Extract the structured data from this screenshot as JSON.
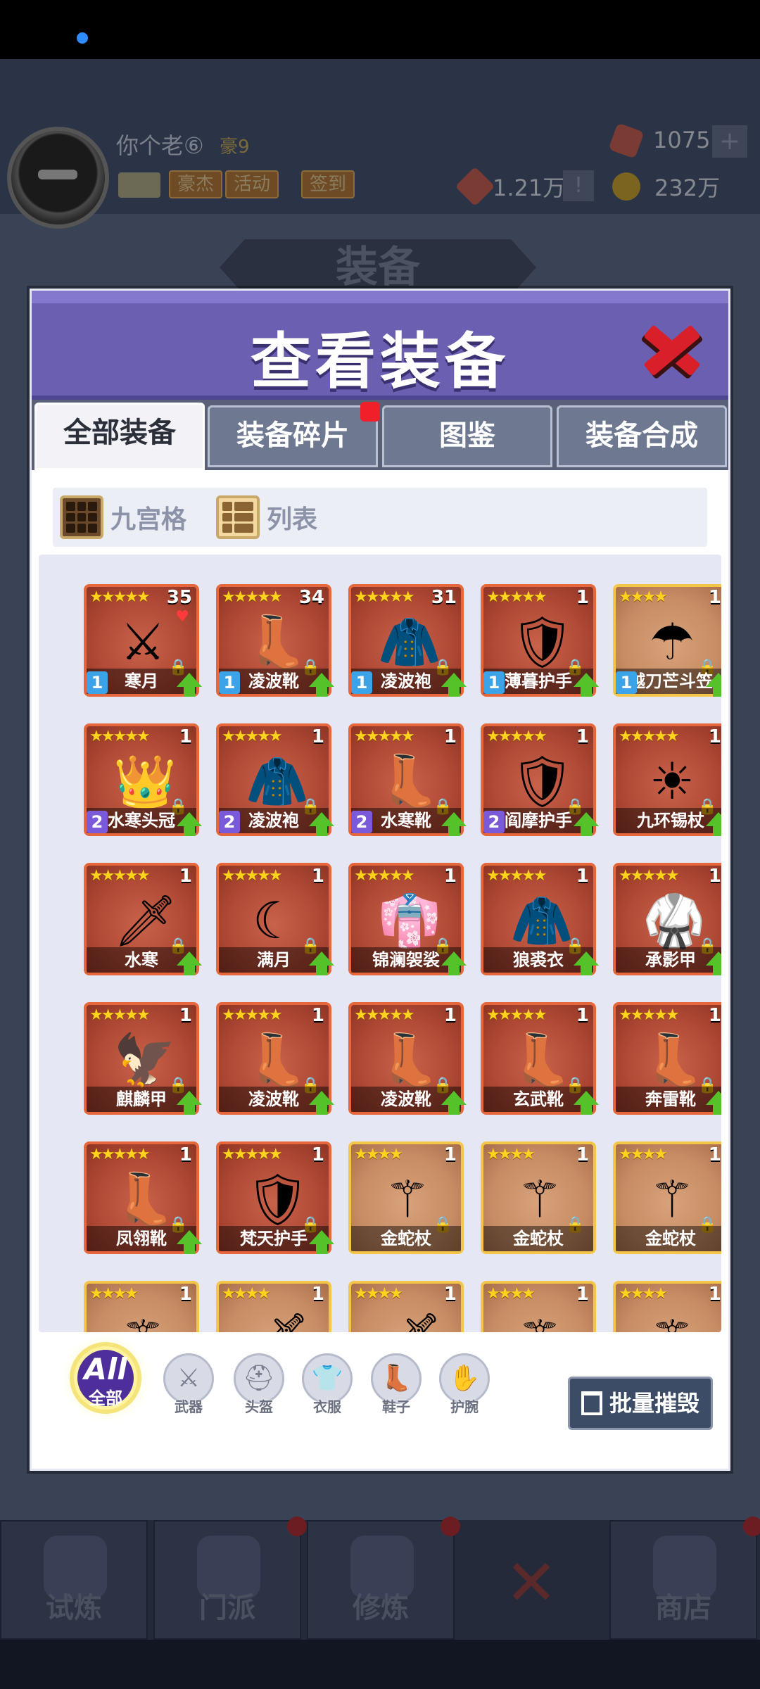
{
  "header": {
    "player_name": "你个老⑥",
    "player_rank": "豪9",
    "tags": [
      "豪杰",
      "活动",
      "签到"
    ],
    "gems": "1075",
    "power": "1.21万",
    "gold": "232万",
    "bg_title": "装备"
  },
  "modal": {
    "title": "查看装备",
    "tabs": [
      {
        "label": "全部装备",
        "active": true
      },
      {
        "label": "装备碎片",
        "badge": true
      },
      {
        "label": "图鉴"
      },
      {
        "label": "装备合成"
      }
    ],
    "view_modes": [
      "九宫格",
      "列表"
    ],
    "filters": {
      "all_label": "All",
      "all_sub": "全部",
      "items": [
        {
          "label": "武器",
          "icon": "swords-icon"
        },
        {
          "label": "头盔",
          "icon": "helmet-icon"
        },
        {
          "label": "衣服",
          "icon": "armor-icon"
        },
        {
          "label": "鞋子",
          "icon": "boots-icon"
        },
        {
          "label": "护腕",
          "icon": "bracer-icon"
        }
      ]
    },
    "batch_button": "批量摧毁"
  },
  "items": [
    {
      "name": "寒月",
      "stars": 5,
      "count": "35",
      "level": "1",
      "rarity": "red",
      "icon": "⚔",
      "heart": true
    },
    {
      "name": "凌波靴",
      "stars": 5,
      "count": "34",
      "level": "1",
      "rarity": "red",
      "icon": "👢"
    },
    {
      "name": "凌波袍",
      "stars": 5,
      "count": "31",
      "level": "1",
      "rarity": "red",
      "icon": "🧥"
    },
    {
      "name": "薄暮护手",
      "stars": 5,
      "count": "1",
      "level": "1",
      "rarity": "red",
      "icon": "🛡"
    },
    {
      "name": "越刀芒斗笠",
      "stars": 4,
      "count": "1",
      "level": "1",
      "rarity": "gold",
      "icon": "☂"
    },
    {
      "name": "水寒头冠",
      "stars": 5,
      "count": "1",
      "level": "2",
      "rarity": "red",
      "icon": "👑"
    },
    {
      "name": "凌波袍",
      "stars": 5,
      "count": "1",
      "level": "2",
      "rarity": "red",
      "icon": "🧥"
    },
    {
      "name": "水寒靴",
      "stars": 5,
      "count": "1",
      "level": "2",
      "rarity": "red",
      "icon": "👢"
    },
    {
      "name": "阎摩护手",
      "stars": 5,
      "count": "1",
      "level": "2",
      "rarity": "red",
      "icon": "🛡"
    },
    {
      "name": "九环锡杖",
      "stars": 5,
      "count": "1",
      "level": "",
      "rarity": "red",
      "icon": "☀"
    },
    {
      "name": "水寒",
      "stars": 5,
      "count": "1",
      "level": "",
      "rarity": "red",
      "icon": "🗡"
    },
    {
      "name": "满月",
      "stars": 5,
      "count": "1",
      "level": "",
      "rarity": "red",
      "icon": "☾"
    },
    {
      "name": "锦澜袈裟",
      "stars": 5,
      "count": "1",
      "level": "",
      "rarity": "red",
      "icon": "👘"
    },
    {
      "name": "狼裘衣",
      "stars": 5,
      "count": "1",
      "level": "",
      "rarity": "red",
      "icon": "🧥"
    },
    {
      "name": "承影甲",
      "stars": 5,
      "count": "1",
      "level": "",
      "rarity": "red",
      "icon": "🥋"
    },
    {
      "name": "麒麟甲",
      "stars": 5,
      "count": "1",
      "level": "",
      "rarity": "red",
      "icon": "🦅"
    },
    {
      "name": "凌波靴",
      "stars": 5,
      "count": "1",
      "level": "",
      "rarity": "red",
      "icon": "👢"
    },
    {
      "name": "凌波靴",
      "stars": 5,
      "count": "1",
      "level": "",
      "rarity": "red",
      "icon": "👢"
    },
    {
      "name": "玄武靴",
      "stars": 5,
      "count": "1",
      "level": "",
      "rarity": "red",
      "icon": "👢"
    },
    {
      "name": "奔雷靴",
      "stars": 5,
      "count": "1",
      "level": "",
      "rarity": "red",
      "icon": "👢"
    },
    {
      "name": "凤翎靴",
      "stars": 5,
      "count": "1",
      "level": "",
      "rarity": "red",
      "icon": "👢"
    },
    {
      "name": "梵天护手",
      "stars": 5,
      "count": "1",
      "level": "",
      "rarity": "red",
      "icon": "🛡"
    },
    {
      "name": "金蛇杖",
      "stars": 4,
      "count": "1",
      "level": "",
      "rarity": "gold",
      "icon": "⚚"
    },
    {
      "name": "金蛇杖",
      "stars": 4,
      "count": "1",
      "level": "",
      "rarity": "gold",
      "icon": "⚚"
    },
    {
      "name": "金蛇杖",
      "stars": 4,
      "count": "1",
      "level": "",
      "rarity": "gold",
      "icon": "⚚"
    },
    {
      "name": "",
      "stars": 4,
      "count": "1",
      "level": "",
      "rarity": "gold",
      "icon": "⚚"
    },
    {
      "name": "",
      "stars": 4,
      "count": "1",
      "level": "",
      "rarity": "gold",
      "icon": "🗡"
    },
    {
      "name": "",
      "stars": 4,
      "count": "1",
      "level": "",
      "rarity": "gold",
      "icon": "🗡"
    },
    {
      "name": "",
      "stars": 4,
      "count": "1",
      "level": "",
      "rarity": "gold",
      "icon": "⚚"
    },
    {
      "name": "",
      "stars": 4,
      "count": "1",
      "level": "",
      "rarity": "gold",
      "icon": "⚚"
    }
  ],
  "bottom_nav": [
    "试炼",
    "门派",
    "修炼",
    "",
    "商店"
  ]
}
